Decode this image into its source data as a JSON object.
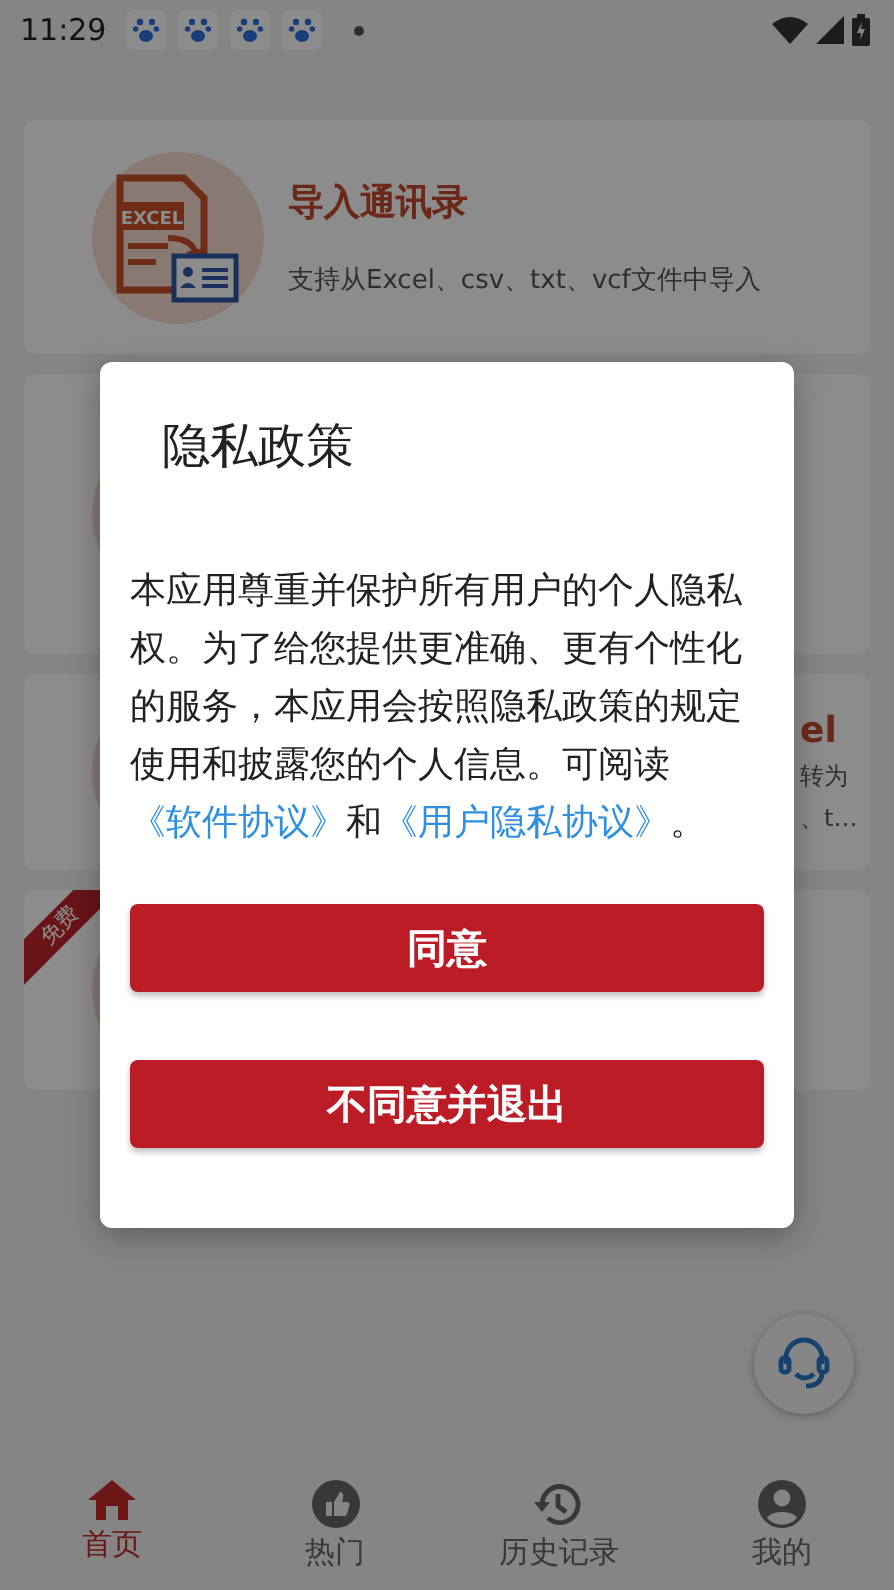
{
  "status_bar": {
    "time": "11:29",
    "notifications": [
      {
        "kind": "paw"
      },
      {
        "kind": "paw"
      },
      {
        "kind": "paw"
      },
      {
        "kind": "paw"
      },
      {
        "kind": "dot"
      }
    ]
  },
  "cards": [
    {
      "kind": "excel",
      "icon_label": "EXCEL",
      "title": "导入通讯录",
      "subtitle_lines": [
        "支持从Excel、csv、txt、vcf文件中导入"
      ]
    },
    {
      "kind": "plain"
    },
    {
      "kind": "partial",
      "title": "el",
      "subtitle_lines": [
        "转为",
        "、t…"
      ]
    },
    {
      "kind": "plain",
      "badge": "免费"
    }
  ],
  "dialog": {
    "title": "隐私政策",
    "body": [
      {
        "kind": "text",
        "text": "本应用尊重并保护所有用户的个人隐私权。为了给您提供更准确、更有个性化的服务，本应用会按照隐私政策的规定使用和披露您的个人信息。可阅读"
      },
      {
        "kind": "link",
        "text": "《软件协议》"
      },
      {
        "kind": "text",
        "text": "和"
      },
      {
        "kind": "link",
        "text": "《用户隐私协议》"
      },
      {
        "kind": "text",
        "text": "。"
      }
    ],
    "buttons": [
      "同意",
      "不同意并退出"
    ]
  },
  "nav": [
    {
      "kind": "home",
      "label": "首页",
      "selected": true
    },
    {
      "kind": "thumb",
      "label": "热门",
      "selected": false
    },
    {
      "kind": "history",
      "label": "历史记录",
      "selected": false
    },
    {
      "kind": "profile",
      "label": "我的",
      "selected": false
    }
  ]
}
